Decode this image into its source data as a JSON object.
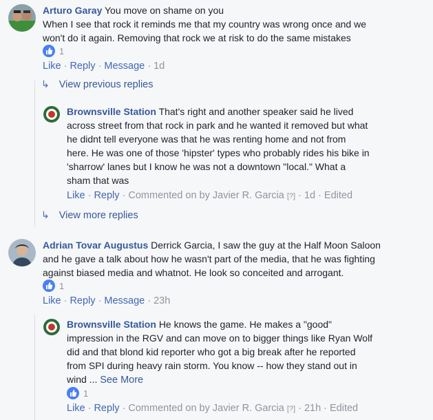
{
  "comments": [
    {
      "author": "Arturo Garay",
      "text_line1": "You move on shame on you",
      "text_line2": "When I see that rock it reminds me that my country was wrong once and we",
      "text_line3": "won't do it again. Removing that rock we at risk to do the same mistakes",
      "likes": "1",
      "actions": {
        "like": "Like",
        "reply": "Reply",
        "message": "Message",
        "time": "1d"
      }
    },
    {
      "author": "Adrian Tovar Augustus",
      "text_line1": "Derrick Garcia, I saw the guy at the Half Moon Saloon",
      "text_line2": "and he gave a talk about how he wasn't part of the media, that he was fighting",
      "text_line3": "against biased media and whatnot. He look so conceited and arrogant.",
      "likes": "1",
      "actions": {
        "like": "Like",
        "reply": "Reply",
        "message": "Message",
        "time": "23h"
      }
    }
  ],
  "thread1": {
    "view_previous": "View previous replies",
    "view_more": "View more replies",
    "reply": {
      "author": "Brownsville Station",
      "line1": "That's right and another speaker said he lived",
      "line2": "across street from that rock in park and he wanted it removed but what",
      "line3": "he didnt tell everyone was that he was renting home and not from",
      "line4": "here. He was one of those 'hipster' types who probably rides his bike in",
      "line5": "'sharrow' lanes but I know he was not a downtown \"local.\" What a",
      "line6": "sham that was",
      "actions": {
        "like": "Like",
        "reply": "Reply",
        "commented_on": "Commented on by Javier R. Garcia",
        "help": "[?]",
        "time": "1d",
        "edited": "Edited"
      }
    }
  },
  "thread2": {
    "reply": {
      "author": "Brownsville Station",
      "line1": "He knows the game. He makes a \"good\"",
      "line2": "impression in the RGV and can move on to bigger things like Ryan Wolf",
      "line3": "did and that blond kid reporter who got a big break after he reported",
      "line4": "from SPI during heavy rain storm. You know -- how they stand out in",
      "line5": "wind ...",
      "see_more": "See More",
      "likes": "1",
      "actions": {
        "like": "Like",
        "reply": "Reply",
        "commented_on": "Commented on by Javier R. Garcia",
        "help": "[?]",
        "time": "21h",
        "edited": "Edited"
      }
    }
  }
}
